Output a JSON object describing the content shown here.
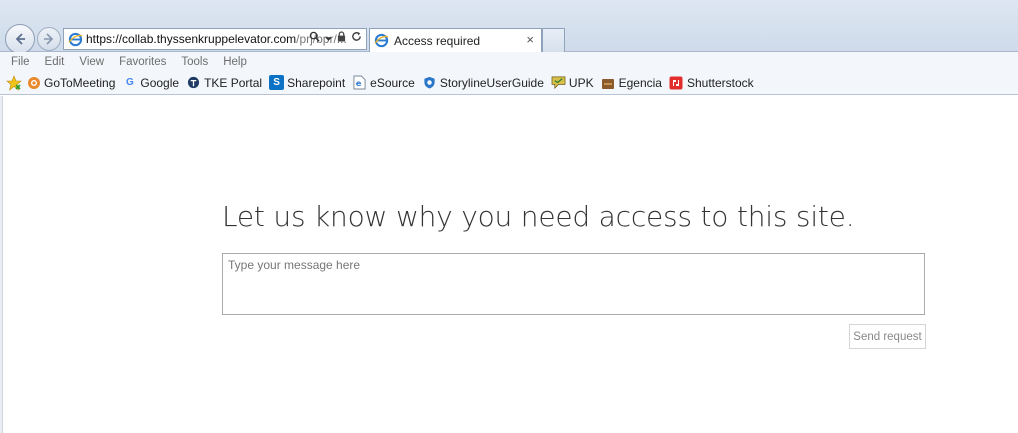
{
  "browser": {
    "address": {
      "url_host": "https://collab.thyssenkruppelevator.com",
      "url_path": "/prj/bpr/..."
    },
    "tabs": [
      {
        "title": "Access required",
        "close": "×"
      }
    ],
    "menu": [
      "File",
      "Edit",
      "View",
      "Favorites",
      "Tools",
      "Help"
    ],
    "favorites": [
      {
        "label": "GoToMeeting",
        "icon": "gotomeeting-icon",
        "color": "#e8892b"
      },
      {
        "label": "Google",
        "icon": "google-icon",
        "color": "#4285f4"
      },
      {
        "label": "TKE Portal",
        "icon": "tke-portal-icon",
        "color": "#1f3b63"
      },
      {
        "label": "Sharepoint",
        "icon": "sharepoint-icon",
        "color": "#0b72c5"
      },
      {
        "label": "eSource",
        "icon": "ie-page-icon",
        "color": "#2b7bd3"
      },
      {
        "label": "StorylineUserGuide",
        "icon": "shield-icon",
        "color": "#2a76c9"
      },
      {
        "label": "UPK",
        "icon": "speech-bubble-icon",
        "color": "#c3a12a"
      },
      {
        "label": "Egencia",
        "icon": "briefcase-icon",
        "color": "#8a5a2b"
      },
      {
        "label": "Shutterstock",
        "icon": "shutterstock-icon",
        "color": "#e32d2d"
      }
    ]
  },
  "page": {
    "headline": "Let us know why you need access to this site.",
    "message_placeholder": "Type your message here",
    "send_label": "Send request"
  }
}
